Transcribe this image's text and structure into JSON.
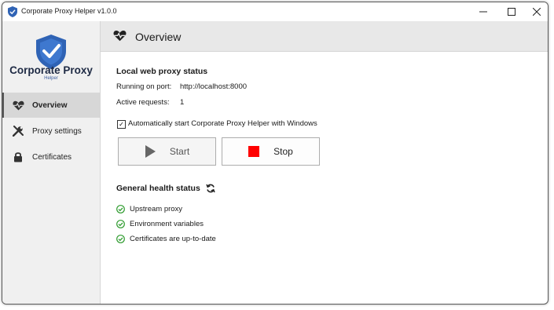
{
  "window": {
    "title": "Corporate Proxy Helper v1.0.0"
  },
  "sidebar": {
    "brand": "Corporate Proxy",
    "brand_sub": "Helper",
    "items": [
      {
        "label": "Overview",
        "icon": "heartbeat-icon",
        "active": true
      },
      {
        "label": "Proxy settings",
        "icon": "tools-icon",
        "active": false
      },
      {
        "label": "Certificates",
        "icon": "lock-icon",
        "active": false
      }
    ]
  },
  "header": {
    "title": "Overview",
    "icon": "heartbeat-icon"
  },
  "status": {
    "title": "Local web proxy status",
    "port_label": "Running on port:",
    "port_value": "http://localhost:8000",
    "requests_label": "Active requests:",
    "requests_value": "1",
    "autostart_label": "Automatically start Corporate Proxy Helper with Windows",
    "autostart_checked": true
  },
  "buttons": {
    "start": "Start",
    "stop": "Stop"
  },
  "health": {
    "title": "General health status",
    "items": [
      "Upstream proxy",
      "Environment variables",
      "Certificates are up-to-date"
    ]
  },
  "colors": {
    "ok_green": "#2e9b2e",
    "stop_red": "#ff0000",
    "brand_blue": "#2f63b5"
  }
}
